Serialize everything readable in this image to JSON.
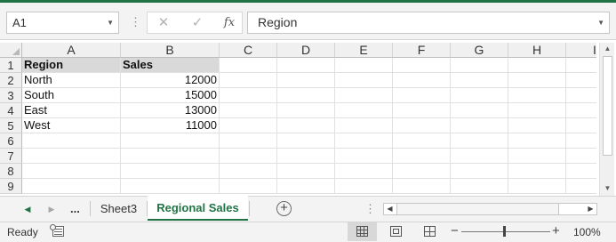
{
  "formula_bar": {
    "name_box": "A1",
    "formula": "Region",
    "cancel_glyph": "✕",
    "enter_glyph": "✓",
    "fx_label": "fx",
    "separator_glyph": "⋮"
  },
  "columns": [
    "A",
    "B",
    "C",
    "D",
    "E",
    "F",
    "G",
    "H",
    "I"
  ],
  "rows": [
    "1",
    "2",
    "3",
    "4",
    "5",
    "6",
    "7",
    "8",
    "9"
  ],
  "cells": {
    "A1": "Region",
    "B1": "Sales",
    "A2": "North",
    "B2": "12000",
    "A3": "South",
    "B3": "15000",
    "A4": "East",
    "B4": "13000",
    "A5": "West",
    "B5": "11000"
  },
  "sheet_tabs": {
    "more": "...",
    "tabs": [
      "Sheet3",
      "Regional Sales"
    ],
    "active": "Regional Sales",
    "add_glyph": "+",
    "split_glyph": "⋮"
  },
  "status_bar": {
    "status": "Ready",
    "zoom_minus": "−",
    "zoom_plus": "+",
    "zoom_level": "100%"
  },
  "icons": {
    "dropdown": "chevron-down-icon",
    "scroll_up": "triangle-up-icon",
    "scroll_down": "triangle-down-icon",
    "scroll_left": "triangle-left-icon",
    "scroll_right": "triangle-right-icon"
  },
  "colors": {
    "accent": "#217346",
    "header_fill": "#d9d9d9"
  }
}
